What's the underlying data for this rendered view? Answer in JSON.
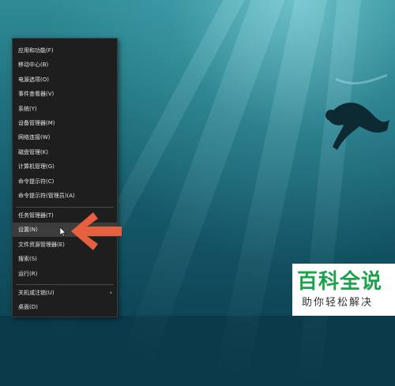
{
  "context_menu": {
    "groups": [
      [
        "应用和功能(F)",
        "移动中心(B)",
        "电源选项(O)",
        "事件查看器(V)",
        "系统(Y)",
        "设备管理器(M)",
        "网络连接(W)",
        "磁盘管理(K)",
        "计算机管理(G)",
        "命令提示符(C)",
        "命令提示符(管理员)(A)"
      ],
      [
        "任务管理器(T)",
        "设置(N)",
        "文件资源管理器(E)",
        "搜索(S)",
        "运行(R)"
      ],
      [
        "关机或注销(U)",
        "桌面(D)"
      ]
    ],
    "highlighted_item": "设置(N)",
    "submenu_item": "关机或注销(U)"
  },
  "watermark": {
    "title": "百科全说",
    "subtitle": "助你轻松解决"
  },
  "colors": {
    "arrow": "#e5603e",
    "logo_green": "#1aa34a",
    "menu_bg": "#1e1e1e"
  }
}
